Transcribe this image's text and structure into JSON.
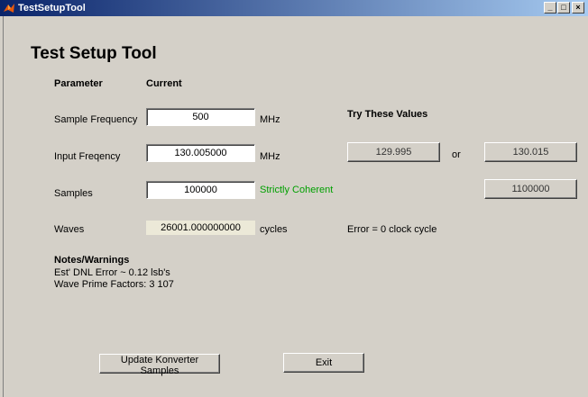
{
  "window": {
    "title": "TestSetupTool",
    "controls": {
      "minimize": "_",
      "maximize": "□",
      "close": "×"
    }
  },
  "header": {
    "title": "Test Setup Tool"
  },
  "columns": {
    "parameter": "Parameter",
    "current": "Current"
  },
  "rows": {
    "sample_frequency": {
      "label": "Sample Frequency",
      "value": "500",
      "unit": "MHz"
    },
    "input_frequency": {
      "label": "Input Freqency",
      "value": "130.005000",
      "unit": "MHz"
    },
    "samples": {
      "label": "Samples",
      "value": "100000",
      "status": "Strictly Coherent"
    },
    "waves": {
      "label": "Waves",
      "value": "26001.000000000",
      "unit": "cycles"
    }
  },
  "suggestions": {
    "heading": "Try These Values",
    "freq_low": "129.995",
    "or_label": "or",
    "freq_high": "130.015",
    "samples_value": "1100000",
    "error_text": "Error = 0 clock cycle"
  },
  "notes": {
    "heading": "Notes/Warnings",
    "lines": [
      "Est' DNL Error ~ 0.12 lsb's",
      "Wave Prime Factors:  3  107"
    ]
  },
  "buttons": {
    "update": "Update Konverter Samples",
    "exit": "Exit"
  },
  "colors": {
    "titlebar_start": "#0a246a",
    "titlebar_end": "#a6caf0",
    "status_green": "#00a000",
    "background": "#d4d0c8"
  }
}
